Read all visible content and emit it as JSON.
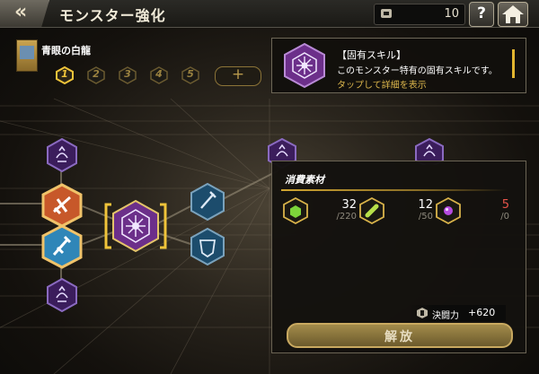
{
  "header": {
    "title": "モンスター強化",
    "currency_count": "10",
    "help_label": "?"
  },
  "card": {
    "name": "青眼の白龍"
  },
  "levels": [
    "1",
    "2",
    "3",
    "4",
    "5"
  ],
  "plus_label": "+",
  "skill": {
    "title": "【固有スキル】",
    "description": "このモンスター特有の固有スキルです。",
    "link": "タップして詳細を表示"
  },
  "materials": {
    "title": "消費素材",
    "items": [
      {
        "current": "32",
        "total": "/220",
        "color": "#7cd43a"
      },
      {
        "current": "12",
        "total": "/50",
        "color": "#b7e04a"
      },
      {
        "current": "5",
        "total": "/0",
        "color": "#b54be0"
      }
    ]
  },
  "power": {
    "label": "決闘力",
    "value": "+620"
  },
  "unlock_label": "解放",
  "colors": {
    "accent_gold": "#e2b52f",
    "purple_node": "#7a3aa8",
    "orange_node": "#e07a2a",
    "teal_node": "#2a6a8a"
  }
}
